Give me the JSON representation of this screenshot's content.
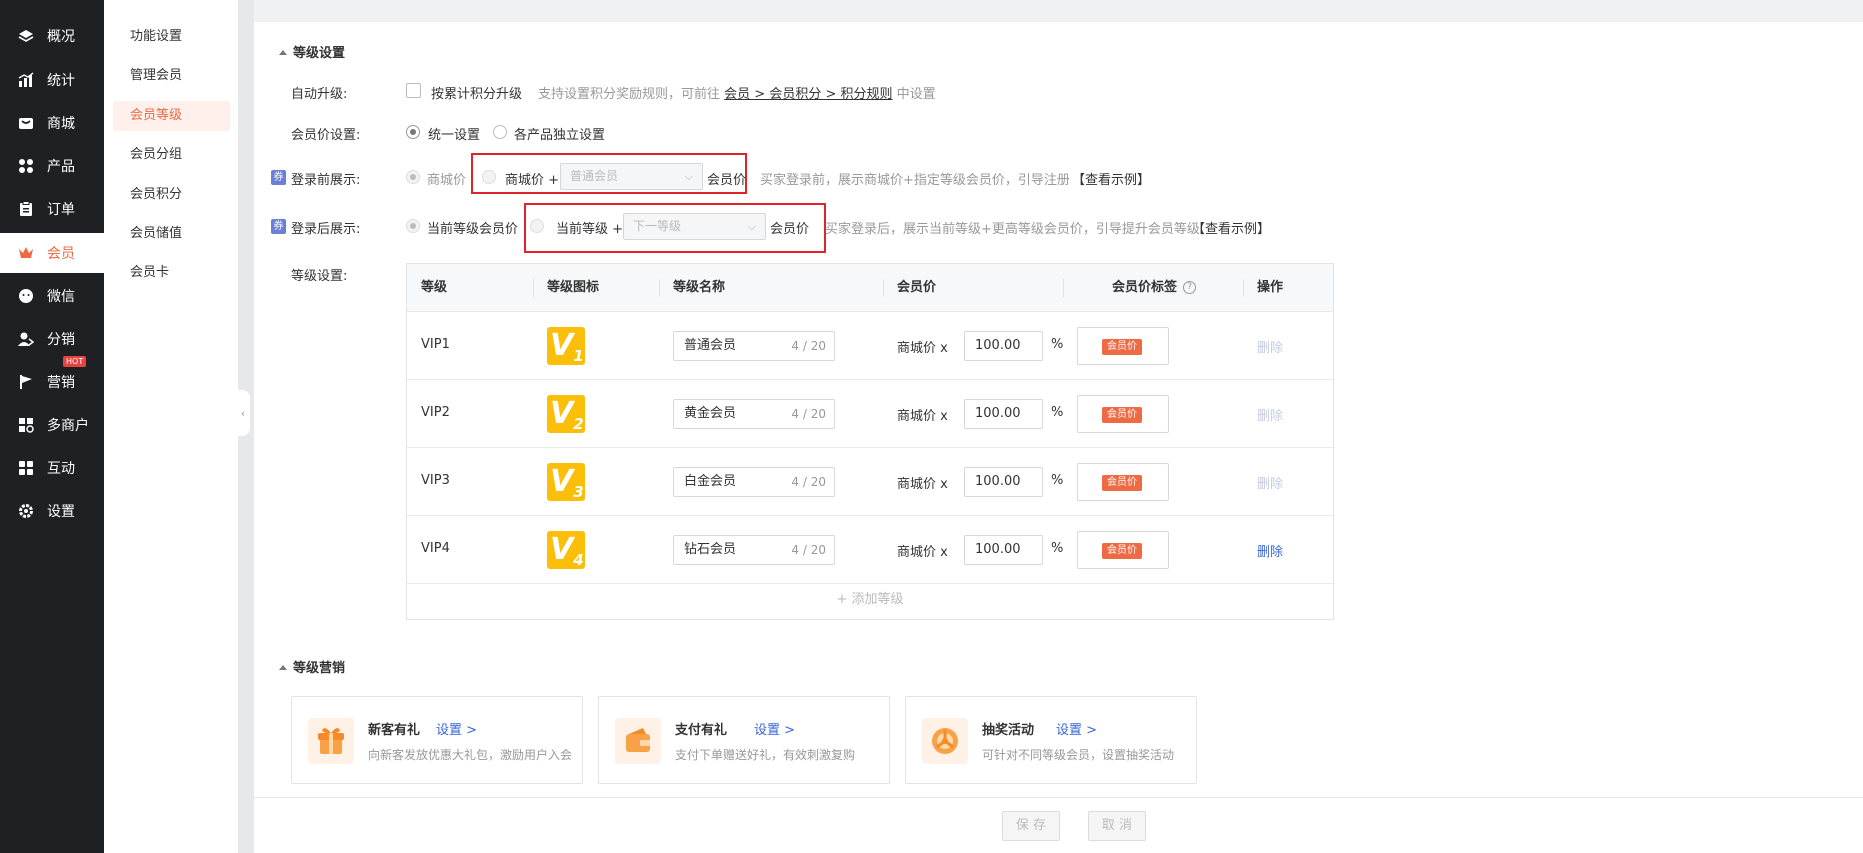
{
  "nav": {
    "items": [
      {
        "label": "概况",
        "icon": "layers-icon"
      },
      {
        "label": "统计",
        "icon": "chart-icon"
      },
      {
        "label": "商城",
        "icon": "store-icon"
      },
      {
        "label": "产品",
        "icon": "grid-icon"
      },
      {
        "label": "订单",
        "icon": "clipboard-icon"
      },
      {
        "label": "会员",
        "icon": "crown-icon"
      },
      {
        "label": "微信",
        "icon": "chat-icon"
      },
      {
        "label": "分销",
        "icon": "user-share-icon"
      },
      {
        "label": "营销",
        "icon": "flag-icon",
        "badge": "HOT"
      },
      {
        "label": "多商户",
        "icon": "shops-icon"
      },
      {
        "label": "互动",
        "icon": "blocks-icon"
      },
      {
        "label": "设置",
        "icon": "gear-icon"
      }
    ],
    "active_index": 5,
    "accent_color": "#ed6a43"
  },
  "subnav": {
    "items": [
      "功能设置",
      "管理会员",
      "会员等级",
      "会员分组",
      "会员积分",
      "会员储值",
      "会员卡"
    ],
    "active_index": 2
  },
  "level_settings": {
    "title": "等级设置",
    "auto_upgrade": {
      "label": "自动升级:",
      "checkbox_label": "按累计积分升级",
      "hint_prefix": "支持设置积分奖励规则，可前往",
      "hint_link": "会员 > 会员积分 > 积分规则",
      "hint_suffix": "中设置"
    },
    "price_setting": {
      "label": "会员价设置:",
      "options": [
        "统一设置",
        "各产品独立设置"
      ]
    },
    "before_login": {
      "badge": "券",
      "label": "登录前展示:",
      "option1": "商城价",
      "option2_prefix": "商城价 +",
      "select_value": "普通会员",
      "option2_suffix": "会员价",
      "hint": "买家登录前，展示商城价+指定等级会员价，引导注册",
      "example_link": "【查看示例】"
    },
    "after_login": {
      "badge": "券",
      "label": "登录后展示:",
      "option1": "当前等级会员价",
      "option2_prefix": "当前等级 +",
      "select_value": "下一等级",
      "option2_suffix": "会员价",
      "hint": "买家登录后，展示当前等级+更高等级会员价，引导提升会员等级",
      "example_link": "【查看示例】"
    },
    "table": {
      "label": "等级设置:",
      "headers": [
        "等级",
        "等级图标",
        "等级名称",
        "会员价",
        "会员价标签",
        "操作"
      ],
      "help_icon": "?",
      "rows": [
        {
          "level": "VIP1",
          "icon_num": "1",
          "name": "普通会员",
          "count": "4 / 20",
          "price_prefix": "商城价 x",
          "discount": "100.00",
          "percent": "%",
          "tag": "会员价",
          "action": "删除",
          "action_enabled": false
        },
        {
          "level": "VIP2",
          "icon_num": "2",
          "name": "黄金会员",
          "count": "4 / 20",
          "price_prefix": "商城价 x",
          "discount": "100.00",
          "percent": "%",
          "tag": "会员价",
          "action": "删除",
          "action_enabled": false
        },
        {
          "level": "VIP3",
          "icon_num": "3",
          "name": "白金会员",
          "count": "4 / 20",
          "price_prefix": "商城价 x",
          "discount": "100.00",
          "percent": "%",
          "tag": "会员价",
          "action": "删除",
          "action_enabled": false
        },
        {
          "level": "VIP4",
          "icon_num": "4",
          "name": "钻石会员",
          "count": "4 / 20",
          "price_prefix": "商城价 x",
          "discount": "100.00",
          "percent": "%",
          "tag": "会员价",
          "action": "删除",
          "action_enabled": true
        }
      ],
      "add_label": "+ 添加等级"
    }
  },
  "level_marketing": {
    "title": "等级营销",
    "cards": [
      {
        "title": "新客有礼",
        "setting": "设置 >",
        "desc": "向新客发放优惠大礼包，激励用户入会",
        "icon": "gift-icon"
      },
      {
        "title": "支付有礼",
        "setting": "设置 >",
        "desc": "支付下单赠送好礼，有效刺激复购",
        "icon": "wallet-icon"
      },
      {
        "title": "抽奖活动",
        "setting": "设置 >",
        "desc": "可针对不同等级会员，设置抽奖活动",
        "icon": "lottery-icon"
      }
    ]
  },
  "footer": {
    "save": "保 存",
    "cancel": "取 消"
  }
}
